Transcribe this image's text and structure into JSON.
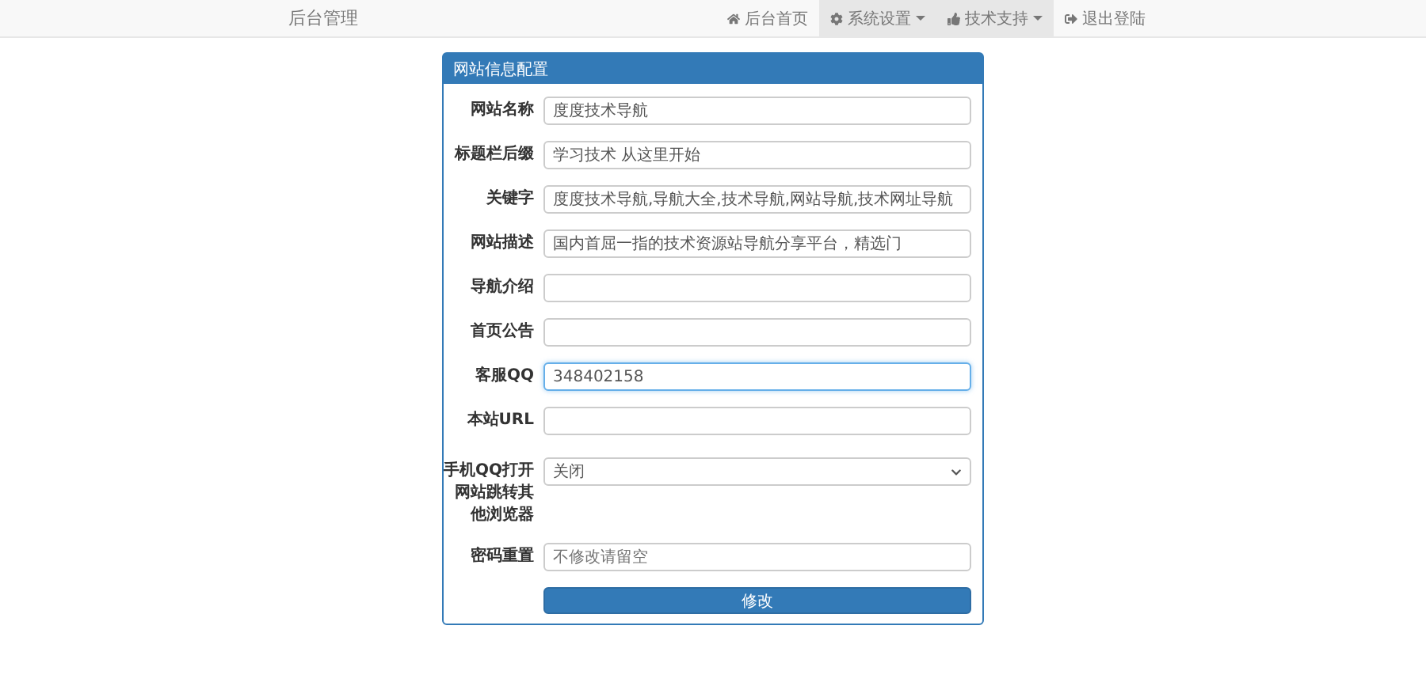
{
  "navbar": {
    "brand": "后台管理",
    "items": [
      {
        "label": "后台首页",
        "selected": false,
        "dropdown": false
      },
      {
        "label": "系统设置",
        "selected": true,
        "dropdown": true
      },
      {
        "label": "技术支持",
        "selected": true,
        "dropdown": true
      },
      {
        "label": "退出登陆",
        "selected": false,
        "dropdown": false
      }
    ]
  },
  "panel": {
    "title": "网站信息配置",
    "fields": [
      {
        "kind": "input",
        "label": "网站名称",
        "value": "度度技术导航",
        "focused": false
      },
      {
        "kind": "input",
        "label": "标题栏后缀",
        "value": "学习技术 从这里开始",
        "focused": false
      },
      {
        "kind": "input",
        "label": "关键字",
        "value": "度度技术导航,导航大全,技术导航,网站导航,技术网址导航",
        "focused": false
      },
      {
        "kind": "input",
        "label": "网站描述",
        "value": "国内首屈一指的技术资源站导航分享平台，精选门",
        "focused": false
      },
      {
        "kind": "input",
        "label": "导航介绍",
        "focused": false
      },
      {
        "kind": "input",
        "label": "首页公告",
        "focused": false
      },
      {
        "kind": "input",
        "label": "客服QQ",
        "value": "348402158",
        "focused": true
      },
      {
        "kind": "input",
        "label": "本站URL",
        "focused": false
      },
      {
        "kind": "select",
        "label": "手机QQ打开网站跳转其他浏览器",
        "value": "关闭",
        "focused": false
      },
      {
        "kind": "input",
        "label": "密码重置",
        "placeholder": "不修改请留空",
        "focused": false
      }
    ],
    "submit": "修改"
  }
}
